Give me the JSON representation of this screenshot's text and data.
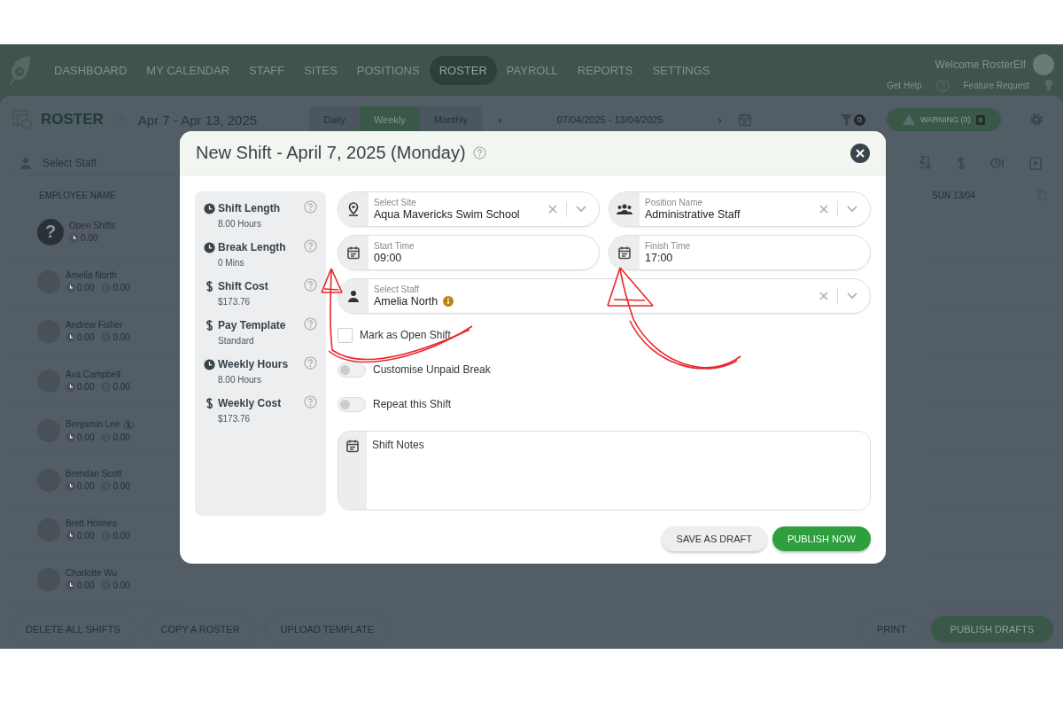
{
  "nav": {
    "items": [
      {
        "label": "DASHBOARD",
        "selected": false
      },
      {
        "label": "MY CALENDAR",
        "selected": false
      },
      {
        "label": "STAFF",
        "selected": false
      },
      {
        "label": "SITES",
        "selected": false
      },
      {
        "label": "POSITIONS",
        "selected": false
      },
      {
        "label": "ROSTER",
        "selected": true
      },
      {
        "label": "PAYROLL",
        "selected": false
      },
      {
        "label": "REPORTS",
        "selected": false
      },
      {
        "label": "SETTINGS",
        "selected": false
      }
    ],
    "welcome": "Welcome RosterElf",
    "help": "Get Help",
    "feature_request": "Feature Request"
  },
  "roster": {
    "title": "ROSTER",
    "range": "Apr 7 - Apr 13, 2025",
    "views": [
      {
        "label": "Daily",
        "selected": false
      },
      {
        "label": "Weekly",
        "selected": true
      },
      {
        "label": "Monthly",
        "selected": false
      }
    ],
    "prev": "‹",
    "next": "›",
    "date_range": "07/04/2025 - 13/04/2025",
    "filter_count": "0",
    "warning": "WARNING (0)",
    "warning_count": "0",
    "staff_placeholder": "Select Staff",
    "columns": [
      "EMPLOYEE NAME",
      "SUN 13/04"
    ],
    "employees": [
      {
        "name": "Open Shifts",
        "kind": "open",
        "avatar": "?",
        "hours": "0.00"
      },
      {
        "name": "Amelia North",
        "kind": "staff",
        "hours": "0.00",
        "cost": "0.00",
        "pay_swap": false
      },
      {
        "name": "Andrew Fisher",
        "kind": "staff",
        "hours": "0.00",
        "cost": "0.00",
        "pay_swap": false
      },
      {
        "name": "Ava Campbell",
        "kind": "staff",
        "hours": "0.00",
        "cost": "0.00",
        "pay_swap": false
      },
      {
        "name": "Benjamin Lee",
        "kind": "staff",
        "hours": "0.00",
        "cost": "0.00",
        "pay_swap": true
      },
      {
        "name": "Brendan Scott",
        "kind": "staff",
        "hours": "0.00",
        "cost": "0.00",
        "pay_swap": false
      },
      {
        "name": "Brett Holmes",
        "kind": "staff",
        "hours": "0.00",
        "cost": "0.00",
        "pay_swap": false
      },
      {
        "name": "Charlotte Wu",
        "kind": "staff",
        "hours": "0.00",
        "cost": "0.00",
        "pay_swap": false
      }
    ],
    "footer_left": [
      "DELETE ALL SHIFTS",
      "COPY A ROSTER",
      "UPLOAD TEMPLATE"
    ],
    "footer_right": [
      {
        "label": "PRINT",
        "kind": "plain"
      },
      {
        "label": "PUBLISH DRAFTS",
        "kind": "primary"
      }
    ]
  },
  "modal": {
    "title": "New Shift - April 7, 2025 (Monday)",
    "summary": [
      {
        "kind": "clock",
        "label": "Shift Length",
        "value": "8.00 Hours"
      },
      {
        "kind": "clock",
        "label": "Break Length",
        "value": "0 Mins"
      },
      {
        "kind": "dollar",
        "label": "Shift Cost",
        "value": "$173.76"
      },
      {
        "kind": "dollar",
        "label": "Pay Template",
        "value": "Standard"
      },
      {
        "kind": "clock",
        "label": "Weekly Hours",
        "value": "8.00 Hours"
      },
      {
        "kind": "dollar",
        "label": "Weekly Cost",
        "value": "$173.76"
      }
    ],
    "site": {
      "label": "Select Site",
      "value": "Aqua Mavericks Swim School"
    },
    "position": {
      "label": "Position Name",
      "value": "Administrative Staff"
    },
    "start_time": {
      "label": "Start Time",
      "value": "09:00"
    },
    "finish_time": {
      "label": "Finish Time",
      "value": "17:00"
    },
    "staff": {
      "label": "Select Staff",
      "value": "Amelia North"
    },
    "open_shift": {
      "label": "Mark as Open Shift",
      "checked": false
    },
    "toggles": [
      {
        "label": "Customise Unpaid Break",
        "on": false
      },
      {
        "label": "Repeat this Shift",
        "on": false
      }
    ],
    "notes": {
      "placeholder": "Shift Notes"
    },
    "buttons": [
      {
        "label": "SAVE AS DRAFT",
        "kind": "secondary"
      },
      {
        "label": "PUBLISH NOW",
        "kind": "primary"
      }
    ]
  }
}
